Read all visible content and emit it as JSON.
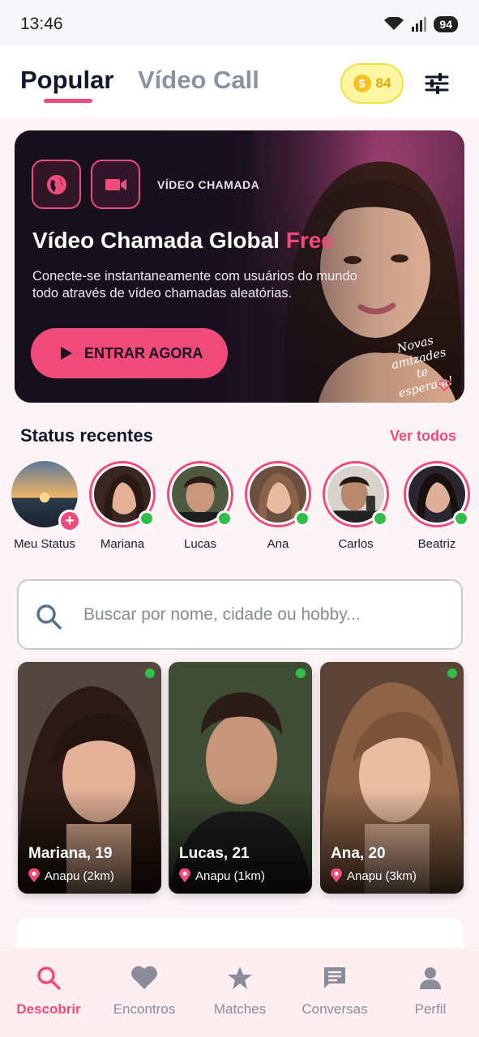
{
  "status_bar": {
    "time": "13:46",
    "battery": "94"
  },
  "header": {
    "tabs": [
      {
        "label": "Popular",
        "active": true
      },
      {
        "label": "Vídeo Call",
        "active": false
      }
    ],
    "coins": "84",
    "filter_icon": "sliders-icon"
  },
  "banner": {
    "tag": "VÍDEO CHAMADA",
    "title": "Vídeo Chamada Global",
    "title_highlight": "Free",
    "description": "Conecte-se instantaneamente com usuários do mundo todo através de vídeo chamadas aleatórias.",
    "cta_label": "ENTRAR AGORA",
    "script_text": "Novas amizades te esperam!"
  },
  "status": {
    "title": "Status recentes",
    "see_all": "Ver todos",
    "items": [
      {
        "name": "Meu Status",
        "mine": true
      },
      {
        "name": "Mariana",
        "online": true
      },
      {
        "name": "Lucas",
        "online": true
      },
      {
        "name": "Ana",
        "online": true
      },
      {
        "name": "Carlos",
        "online": true
      },
      {
        "name": "Beatriz",
        "online": true
      }
    ]
  },
  "search": {
    "placeholder": "Buscar por nome, cidade ou hobby...",
    "value": ""
  },
  "profiles": [
    {
      "name": "Mariana, 19",
      "location": "Anapu (2km)",
      "online": true
    },
    {
      "name": "Lucas, 21",
      "location": "Anapu (1km)",
      "online": true
    },
    {
      "name": "Ana, 20",
      "location": "Anapu (3km)",
      "online": true
    }
  ],
  "bottom_nav": [
    {
      "label": "Descobrir",
      "icon": "search-icon",
      "active": true
    },
    {
      "label": "Encontros",
      "icon": "heart-icon",
      "active": false
    },
    {
      "label": "Matches",
      "icon": "star-icon",
      "active": false
    },
    {
      "label": "Conversas",
      "icon": "chat-icon",
      "active": false
    },
    {
      "label": "Perfil",
      "icon": "person-icon",
      "active": false
    }
  ],
  "colors": {
    "accent": "#f04b7a",
    "online": "#2fbf4a",
    "coin": "#f6c21b",
    "dark": "#12182c"
  }
}
